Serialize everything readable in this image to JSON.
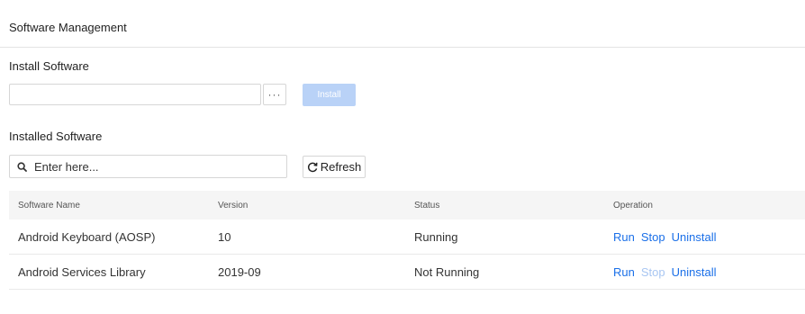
{
  "page": {
    "title": "Software Management"
  },
  "install": {
    "section_title": "Install Software",
    "file_value": "",
    "browse_label": "···",
    "install_label": "Install"
  },
  "installed": {
    "section_title": "Installed Software",
    "search_placeholder": "Enter here...",
    "search_icon": "search-icon",
    "refresh_label": "Refresh",
    "refresh_icon": "refresh-icon"
  },
  "table": {
    "columns": [
      "Software Name",
      "Version",
      "Status",
      "Operation"
    ],
    "rows": [
      {
        "name": "Android Keyboard (AOSP)",
        "version": "10",
        "status": "Running",
        "ops": [
          {
            "label": "Run",
            "enabled": true
          },
          {
            "label": "Stop",
            "enabled": true
          },
          {
            "label": "Uninstall",
            "enabled": true
          }
        ]
      },
      {
        "name": "Android Services Library",
        "version": "2019-09",
        "status": "Not Running",
        "ops": [
          {
            "label": "Run",
            "enabled": true
          },
          {
            "label": "Stop",
            "enabled": false
          },
          {
            "label": "Uninstall",
            "enabled": true
          }
        ]
      }
    ]
  },
  "colors": {
    "link": "#1a6fe8",
    "link_disabled": "#a8c6f2",
    "primary_disabled": "#b9d2f7",
    "header_bg": "#f5f5f5"
  }
}
